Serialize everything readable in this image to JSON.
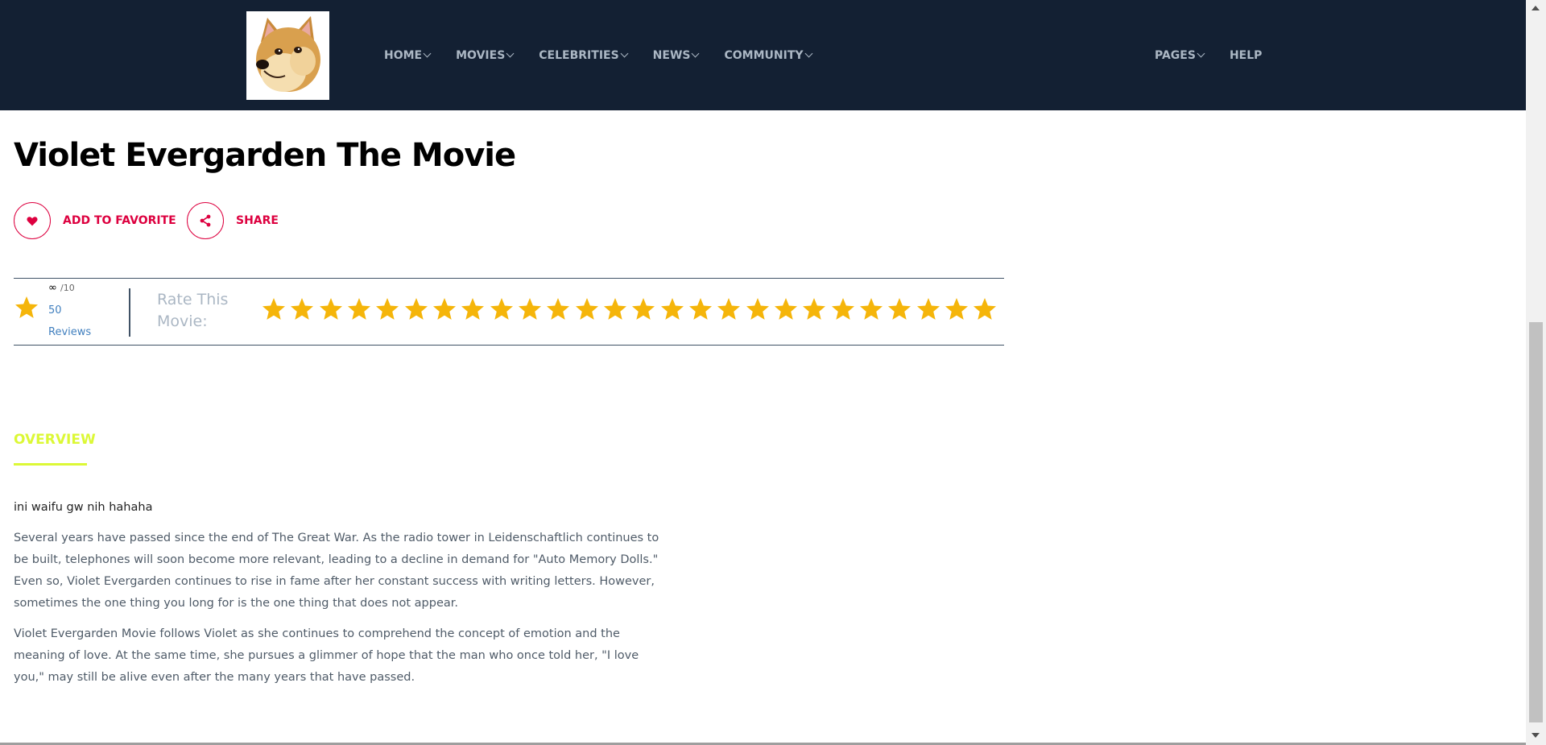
{
  "colors": {
    "nav_bg": "#132033",
    "accent": "#dd003f",
    "star": "#f5b50a",
    "tab_active": "#dcf836",
    "link": "#4280bf"
  },
  "logo": {
    "icon": "doge-logo"
  },
  "nav": {
    "left": [
      {
        "label": "HOME",
        "dropdown": true
      },
      {
        "label": "MOVIES",
        "dropdown": true
      },
      {
        "label": "CELEBRITIES",
        "dropdown": true
      },
      {
        "label": "NEWS",
        "dropdown": true
      },
      {
        "label": "COMMUNITY",
        "dropdown": true
      }
    ],
    "right": [
      {
        "label": "PAGES",
        "dropdown": true
      },
      {
        "label": "HELP",
        "dropdown": false
      }
    ]
  },
  "movie": {
    "title": "Violet Evergarden The Movie",
    "actions": {
      "favorite": "ADD TO FAVORITE",
      "share": "SHARE"
    }
  },
  "rating": {
    "score": "∞",
    "out_of": "/10",
    "reviews_count": "50",
    "reviews_label": "Reviews",
    "rate_label": "Rate This Movie:",
    "star_count": 26
  },
  "tabs": {
    "overview": "OVERVIEW"
  },
  "overview": {
    "intro": "ini waifu gw nih hahaha",
    "paragraphs": [
      "Several years have passed since the end of The Great War. As the radio tower in Leidenschaftlich continues to be built, telephones will soon become more relevant, leading to a decline in demand for \"Auto Memory Dolls.\" Even so, Violet Evergarden continues to rise in fame after her constant success with writing letters. However, sometimes the one thing you long for is the one thing that does not appear.",
      "Violet Evergarden Movie follows Violet as she continues to comprehend the concept of emotion and the meaning of love. At the same time, she pursues a glimmer of hope that the man who once told her, \"I love you,\" may still be alive even after the many years that have passed."
    ]
  }
}
